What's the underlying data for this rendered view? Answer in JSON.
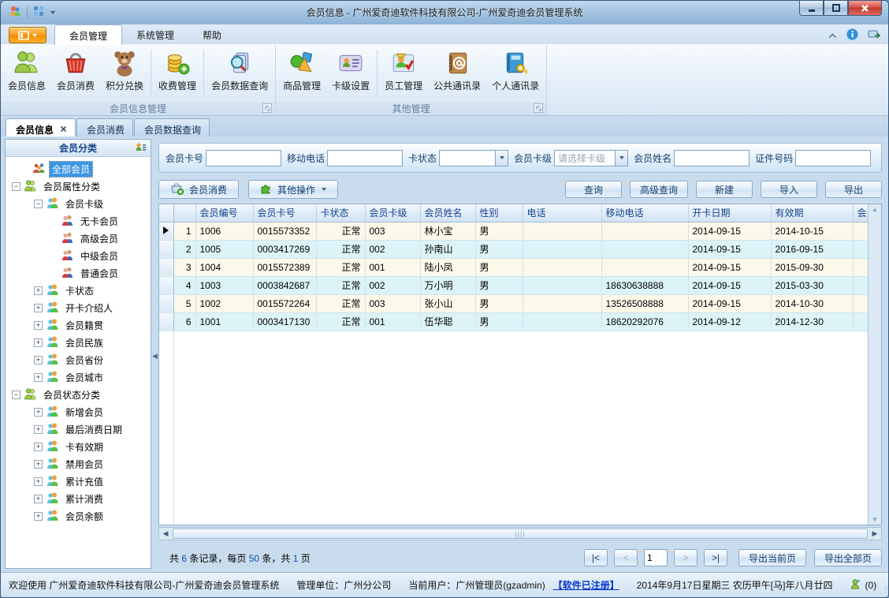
{
  "window": {
    "title": "会员信息 - 广州爱奇迪软件科技有限公司-广州爱奇迪会员管理系统"
  },
  "ribbon": {
    "tabs": [
      {
        "label": "会员管理"
      },
      {
        "label": "系统管理"
      },
      {
        "label": "帮助"
      }
    ],
    "groups": [
      {
        "label": "会员信息管理",
        "buttons": [
          {
            "label": "会员信息"
          },
          {
            "label": "会员消费"
          },
          {
            "label": "积分兑换"
          },
          {
            "label": "收费管理"
          },
          {
            "label": "会员数据查询"
          }
        ]
      },
      {
        "label": "其他管理",
        "buttons": [
          {
            "label": "商品管理"
          },
          {
            "label": "卡级设置"
          },
          {
            "label": "员工管理"
          },
          {
            "label": "公共通讯录"
          },
          {
            "label": "个人通讯录"
          }
        ]
      }
    ]
  },
  "doc_tabs": [
    {
      "label": "会员信息"
    },
    {
      "label": "会员消费"
    },
    {
      "label": "会员数据查询"
    }
  ],
  "sidebar": {
    "header": "会员分类",
    "tree": [
      {
        "label": "全部会员"
      },
      {
        "label": "会员属性分类"
      },
      {
        "label": "会员卡级"
      },
      {
        "label": "无卡会员"
      },
      {
        "label": "高级会员"
      },
      {
        "label": "中级会员"
      },
      {
        "label": "普通会员"
      },
      {
        "label": "卡状态"
      },
      {
        "label": "开卡介绍人"
      },
      {
        "label": "会员籍贯"
      },
      {
        "label": "会员民族"
      },
      {
        "label": "会员省份"
      },
      {
        "label": "会员城市"
      },
      {
        "label": "会员状态分类"
      },
      {
        "label": "新增会员"
      },
      {
        "label": "最后消费日期"
      },
      {
        "label": "卡有效期"
      },
      {
        "label": "禁用会员"
      },
      {
        "label": "累计充值"
      },
      {
        "label": "累计消费"
      },
      {
        "label": "会员余额"
      }
    ]
  },
  "filters": {
    "card_no_label": "会员卡号",
    "mobile_label": "移动电话",
    "card_status_label": "卡状态",
    "card_level_label": "会员卡级",
    "card_level_value": "请选择卡级",
    "name_label": "会员姓名",
    "id_no_label": "证件号码"
  },
  "toolbar": {
    "member_consume": "会员消费",
    "other_ops": "其他操作",
    "query": "查询",
    "adv_query": "高级查询",
    "new": "新建",
    "import": "导入",
    "export": "导出"
  },
  "table": {
    "columns": [
      "会员编号",
      "会员卡号",
      "卡状态",
      "会员卡级",
      "会员姓名",
      "性别",
      "电话",
      "移动电话",
      "开卡日期",
      "有效期",
      "会员"
    ],
    "rows": [
      {
        "num": "1",
        "cells": [
          "1006",
          "0015573352",
          "正常",
          "003",
          "林小宝",
          "男",
          "",
          "",
          "2014-09-15",
          "2014-10-15"
        ]
      },
      {
        "num": "2",
        "cells": [
          "1005",
          "0003417269",
          "正常",
          "002",
          "孙南山",
          "男",
          "",
          "",
          "2014-09-15",
          "2016-09-15"
        ]
      },
      {
        "num": "3",
        "cells": [
          "1004",
          "0015572389",
          "正常",
          "001",
          "陆小凤",
          "男",
          "",
          "",
          "2014-09-15",
          "2015-09-30"
        ]
      },
      {
        "num": "4",
        "cells": [
          "1003",
          "0003842687",
          "正常",
          "002",
          "万小明",
          "男",
          "",
          "18630638888",
          "2014-09-15",
          "2015-03-30"
        ]
      },
      {
        "num": "5",
        "cells": [
          "1002",
          "0015572264",
          "正常",
          "003",
          "张小山",
          "男",
          "",
          "13526508888",
          "2014-09-15",
          "2014-10-30"
        ]
      },
      {
        "num": "6",
        "cells": [
          "1001",
          "0003417130",
          "正常",
          "001",
          "伍华聪",
          "男",
          "",
          "18620292076",
          "2014-09-12",
          "2014-12-30"
        ]
      }
    ]
  },
  "pagination": {
    "sum_p1": "共 ",
    "sum_count": "6",
    "sum_p2": " 条记录，每页 ",
    "sum_per": "50",
    "sum_p3": " 条，共 ",
    "sum_pages": "1",
    "sum_p4": " 页",
    "first": "|<",
    "prev": "<",
    "page": "1",
    "next": ">",
    "last": ">|",
    "export_current": "导出当前页",
    "export_all": "导出全部页"
  },
  "statusbar": {
    "welcome": "欢迎使用 广州爱奇迪软件科技有限公司-广州爱奇迪会员管理系统",
    "org": "管理单位：广州分公司",
    "user": "当前用户：广州管理员(gzadmin)",
    "register": "【软件已注册】",
    "date": "2014年9月17日星期三 农历甲午[马]年八月廿四",
    "messages": "(0)"
  }
}
